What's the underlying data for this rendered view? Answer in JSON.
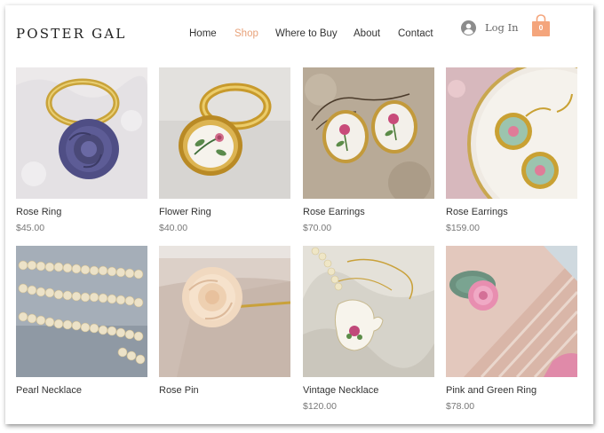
{
  "header": {
    "brand": "POSTER GAL",
    "nav": [
      {
        "label": "Home",
        "active": false
      },
      {
        "label": "Shop",
        "active": true
      },
      {
        "label": "Where to Buy",
        "active": false
      },
      {
        "label": "About",
        "active": false
      },
      {
        "label": "Contact",
        "active": false
      }
    ],
    "login_label": "Log In",
    "cart_count": "0",
    "accent_color": "#f4a57c"
  },
  "products": [
    {
      "name": "Rose Ring",
      "price": "$45.00",
      "image": "purple-rose-ring-photo"
    },
    {
      "name": "Flower Ring",
      "price": "$40.00",
      "image": "flower-ring-photo"
    },
    {
      "name": "Rose Earrings",
      "price": "$70.00",
      "image": "rose-earrings-photo"
    },
    {
      "name": "Rose Earrings",
      "price": "$159.00",
      "image": "gold-rose-earrings-photo"
    },
    {
      "name": "Pearl Necklace",
      "price": "",
      "image": "pearl-necklace-photo"
    },
    {
      "name": "Rose Pin",
      "price": "",
      "image": "rose-pin-photo"
    },
    {
      "name": "Vintage Necklace",
      "price": "$120.00",
      "image": "vintage-necklace-photo"
    },
    {
      "name": "Pink and Green Ring",
      "price": "$78.00",
      "image": "pink-green-ring-photo"
    }
  ]
}
